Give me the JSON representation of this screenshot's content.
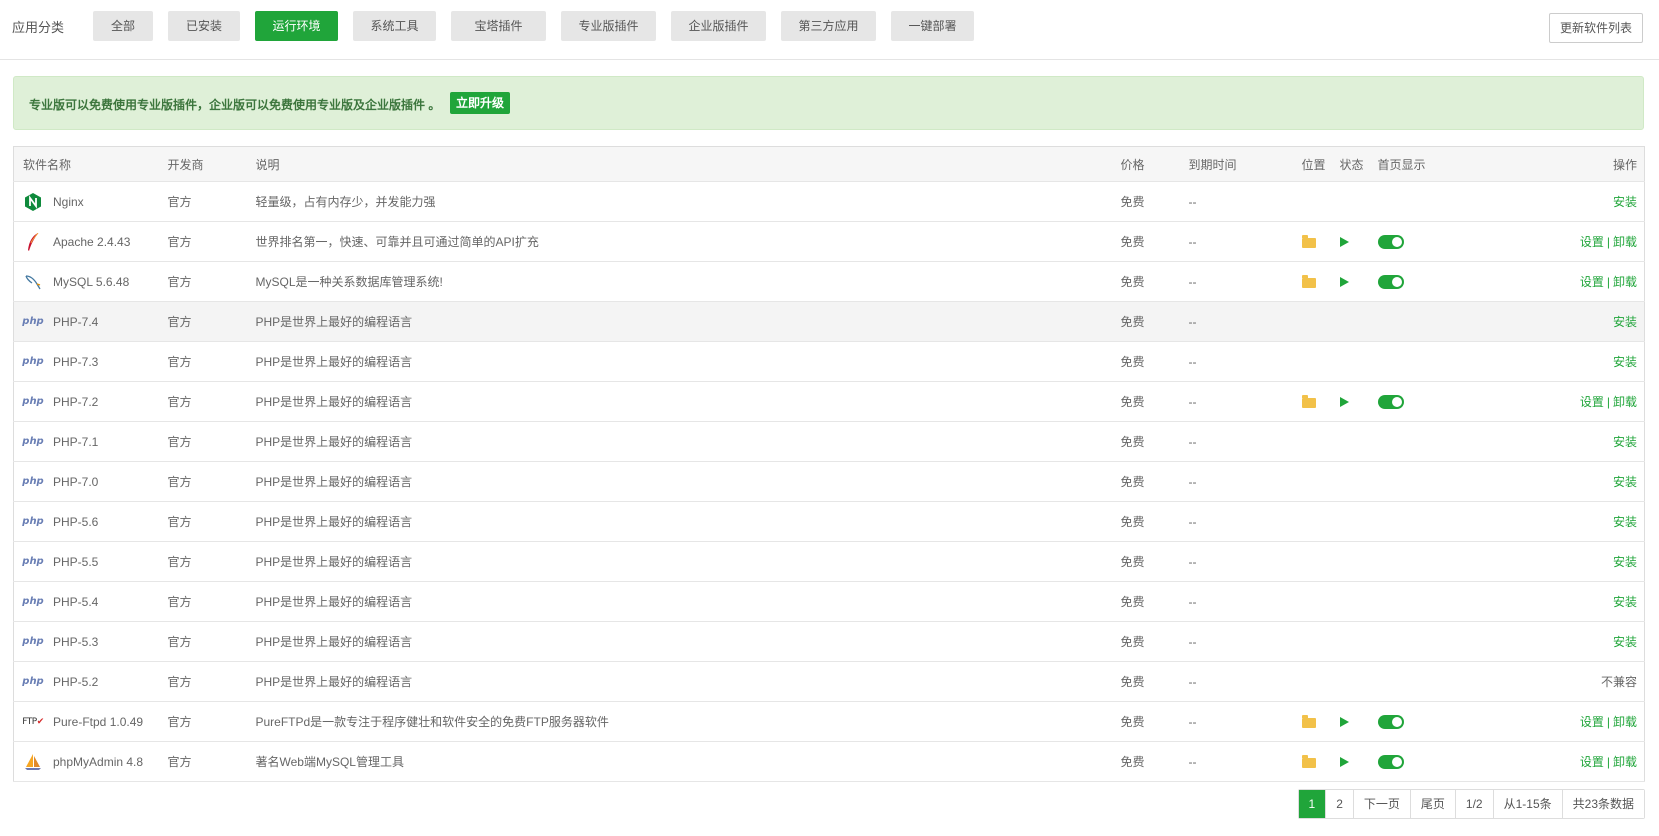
{
  "header": {
    "category_label": "应用分类",
    "categories": [
      "全部",
      "已安装",
      "运行环境",
      "系统工具",
      "宝塔插件",
      "专业版插件",
      "企业版插件",
      "第三方应用",
      "一键部署"
    ],
    "active_category": "运行环境",
    "update_button": "更新软件列表"
  },
  "notice": {
    "text": "专业版可以免费使用专业版插件，企业版可以免费使用专业版及企业版插件 。",
    "upgrade_button": "立即升级"
  },
  "table": {
    "columns": {
      "name": "软件名称",
      "vendor": "开发商",
      "desc": "说明",
      "price": "价格",
      "expire": "到期时间",
      "location": "位置",
      "status": "状态",
      "home": "首页显示",
      "ops": "操作"
    },
    "rows": [
      {
        "icon": "nginx-icon",
        "name": "Nginx",
        "vendor": "官方",
        "desc": "轻量级，占有内存少，并发能力强",
        "price": "免费",
        "expire": "--",
        "installed": false,
        "op": "安装"
      },
      {
        "icon": "apache-feather-icon",
        "name": "Apache 2.4.43",
        "vendor": "官方",
        "desc": "世界排名第一，快速、可靠并且可通过简单的API扩充",
        "price": "免费",
        "expire": "--",
        "installed": true,
        "op_settings": "设置",
        "op_uninstall": "卸载"
      },
      {
        "icon": "mysql-dolphin-icon",
        "name": "MySQL 5.6.48",
        "vendor": "官方",
        "desc": "MySQL是一种关系数据库管理系统!",
        "price": "免费",
        "expire": "--",
        "installed": true,
        "op_settings": "设置",
        "op_uninstall": "卸载"
      },
      {
        "icon": "php-icon",
        "name": "PHP-7.4",
        "vendor": "官方",
        "desc": "PHP是世界上最好的编程语言",
        "price": "免费",
        "expire": "--",
        "installed": false,
        "op": "安装",
        "highlight": true
      },
      {
        "icon": "php-icon",
        "name": "PHP-7.3",
        "vendor": "官方",
        "desc": "PHP是世界上最好的编程语言",
        "price": "免费",
        "expire": "--",
        "installed": false,
        "op": "安装"
      },
      {
        "icon": "php-icon",
        "name": "PHP-7.2",
        "vendor": "官方",
        "desc": "PHP是世界上最好的编程语言",
        "price": "免费",
        "expire": "--",
        "installed": true,
        "op_settings": "设置",
        "op_uninstall": "卸载"
      },
      {
        "icon": "php-icon",
        "name": "PHP-7.1",
        "vendor": "官方",
        "desc": "PHP是世界上最好的编程语言",
        "price": "免费",
        "expire": "--",
        "installed": false,
        "op": "安装"
      },
      {
        "icon": "php-icon",
        "name": "PHP-7.0",
        "vendor": "官方",
        "desc": "PHP是世界上最好的编程语言",
        "price": "免费",
        "expire": "--",
        "installed": false,
        "op": "安装"
      },
      {
        "icon": "php-icon",
        "name": "PHP-5.6",
        "vendor": "官方",
        "desc": "PHP是世界上最好的编程语言",
        "price": "免费",
        "expire": "--",
        "installed": false,
        "op": "安装"
      },
      {
        "icon": "php-icon",
        "name": "PHP-5.5",
        "vendor": "官方",
        "desc": "PHP是世界上最好的编程语言",
        "price": "免费",
        "expire": "--",
        "installed": false,
        "op": "安装"
      },
      {
        "icon": "php-icon",
        "name": "PHP-5.4",
        "vendor": "官方",
        "desc": "PHP是世界上最好的编程语言",
        "price": "免费",
        "expire": "--",
        "installed": false,
        "op": "安装"
      },
      {
        "icon": "php-icon",
        "name": "PHP-5.3",
        "vendor": "官方",
        "desc": "PHP是世界上最好的编程语言",
        "price": "免费",
        "expire": "--",
        "installed": false,
        "op": "安装"
      },
      {
        "icon": "php-icon",
        "name": "PHP-5.2",
        "vendor": "官方",
        "desc": "PHP是世界上最好的编程语言",
        "price": "免费",
        "expire": "--",
        "installed": false,
        "op": "不兼容",
        "op_disabled": true
      },
      {
        "icon": "ftp-icon",
        "name": "Pure-Ftpd 1.0.49",
        "vendor": "官方",
        "desc": "PureFTPd是一款专注于程序健壮和软件安全的免费FTP服务器软件",
        "price": "免费",
        "expire": "--",
        "installed": true,
        "op_settings": "设置",
        "op_uninstall": "卸载"
      },
      {
        "icon": "phpmyadmin-sailboat-icon",
        "name": "phpMyAdmin 4.8",
        "vendor": "官方",
        "desc": "著名Web端MySQL管理工具",
        "price": "免费",
        "expire": "--",
        "installed": true,
        "op_settings": "设置",
        "op_uninstall": "卸载"
      }
    ]
  },
  "pagination": {
    "pages": [
      "1",
      "2"
    ],
    "current": "1",
    "next": "下一页",
    "last": "尾页",
    "page_info": "1/2",
    "range": "从1-15条",
    "total": "共23条数据"
  },
  "icons": {
    "php_glyph": "php",
    "ftp_glyph": "FTP"
  },
  "colors": {
    "accent": "#20a53a",
    "notice_bg": "#dff0d8",
    "notice_text": "#3c763d"
  }
}
